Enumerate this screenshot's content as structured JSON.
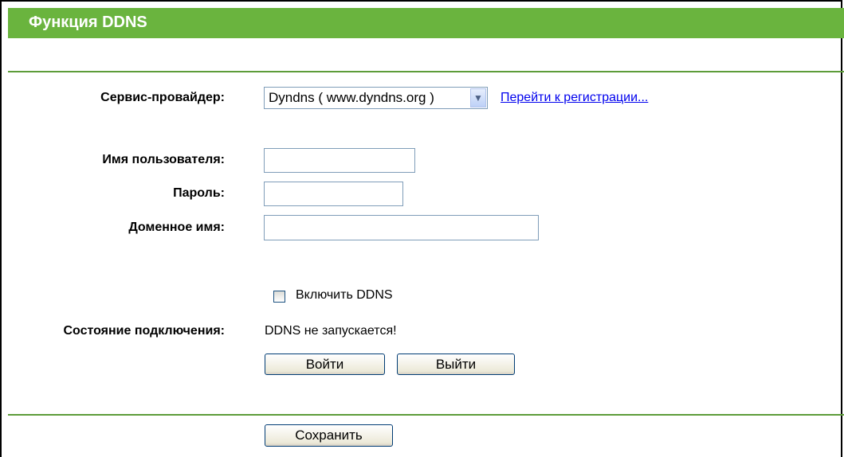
{
  "header": {
    "title": "Функция DDNS"
  },
  "form": {
    "provider_label": "Сервис-провайдер:",
    "provider_value": "Dyndns ( www.dyndns.org )",
    "register_link": "Перейти к регистрации...",
    "username_label": "Имя пользователя:",
    "username_value": "",
    "password_label": "Пароль:",
    "password_value": "",
    "domain_label": "Доменное имя:",
    "domain_value": "",
    "enable_label": "Включить DDNS",
    "enable_checked": false,
    "status_label": "Состояние подключения:",
    "status_value": "DDNS не запускается!"
  },
  "buttons": {
    "login": "Войти",
    "logout": "Выйти",
    "save": "Сохранить"
  },
  "colors": {
    "header_bg": "#6ab43e",
    "divider": "#5d9c3a",
    "link": "#0000ee"
  },
  "icons": {
    "dropdown": "chevron-down-icon"
  }
}
